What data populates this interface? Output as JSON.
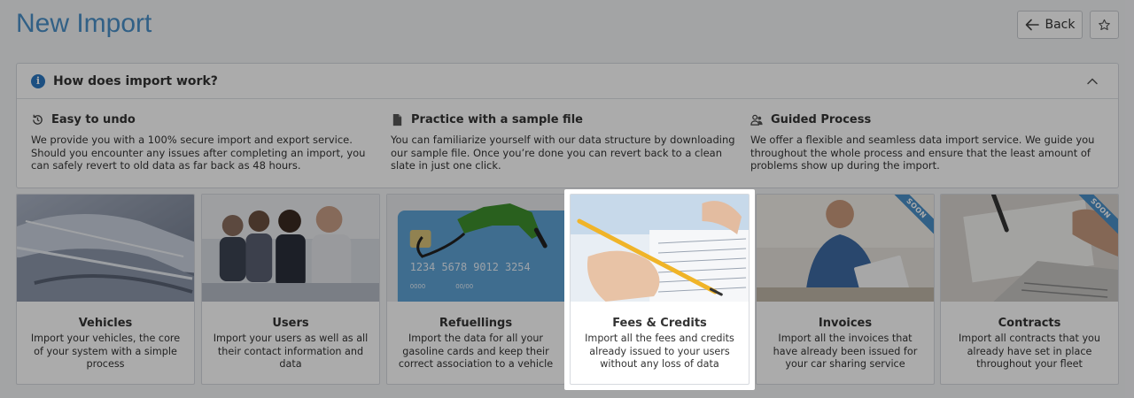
{
  "page": {
    "title": "New Import"
  },
  "header": {
    "back_label": "Back"
  },
  "panel": {
    "title": "How does import work?",
    "features": [
      {
        "title": "Easy to undo",
        "text": "We provide you with a 100% secure import and export service. Should you encounter any issues after completing an import, you can safely revert to old data as far back as 48 hours."
      },
      {
        "title": "Practice with a sample file",
        "text": "You can familiarize yourself with our data structure by downloading our sample file. Once you’re done you can revert back to a clean slate in just one click."
      },
      {
        "title": "Guided Process",
        "text": "We offer a flexible and seamless data import service. We guide you throughout the whole process and ensure that the least amount of problems show up during the import."
      }
    ]
  },
  "cards": [
    {
      "title": "Vehicles",
      "desc": "Import your vehicles, the core of your system with a simple process"
    },
    {
      "title": "Users",
      "desc": "Import your users as well as all their contact information and data"
    },
    {
      "title": "Refuellings",
      "desc": "Import the data for all your gasoline cards and keep their correct association to a vehicle",
      "card_number": "1234  5678  9012  3254",
      "card_small": "0000",
      "card_expiry": "00/00"
    },
    {
      "title": "Fees & Credits",
      "desc": "Import all the fees and credits already issued to your users without any loss of data"
    },
    {
      "title": "Invoices",
      "desc": "Import all the invoices that have already been issued for your car sharing service",
      "badge": "SOON"
    },
    {
      "title": "Contracts",
      "desc": "Import all contracts that you already have set in place throughout your fleet",
      "badge": "SOON"
    }
  ],
  "colors": {
    "accent": "#4a90c8",
    "info": "#2a77c0"
  }
}
